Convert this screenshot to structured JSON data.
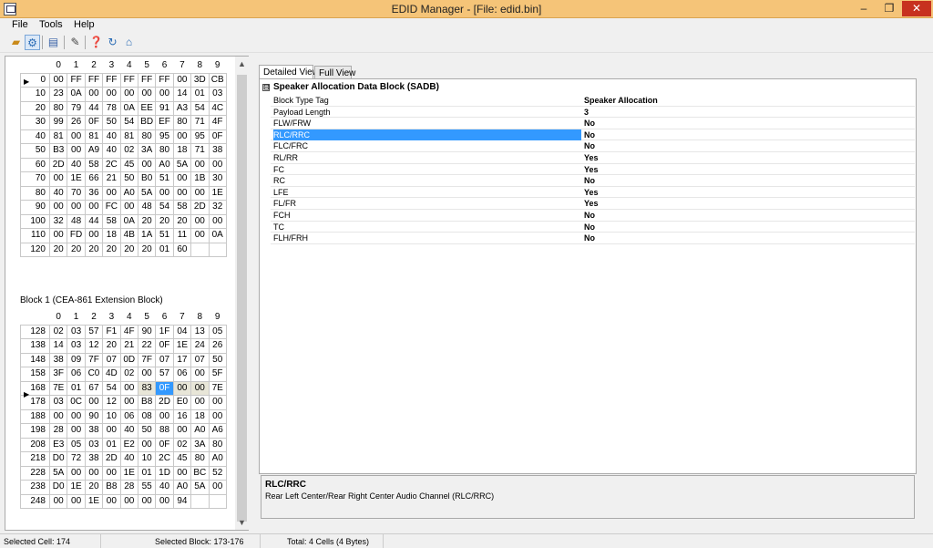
{
  "window": {
    "title": "EDID Manager - [File: edid.bin]"
  },
  "menu": {
    "file": "File",
    "tools": "Tools",
    "help": "Help"
  },
  "toolbar": {
    "icons": [
      "open-folder-icon",
      "settings-icon",
      "save-icon",
      "edit-icon",
      "help-icon",
      "refresh-icon",
      "home-icon"
    ]
  },
  "block0": {
    "columns": [
      "0",
      "1",
      "2",
      "3",
      "4",
      "5",
      "6",
      "7",
      "8",
      "9"
    ],
    "rows": [
      {
        "label": "0",
        "cells": [
          "00",
          "FF",
          "FF",
          "FF",
          "FF",
          "FF",
          "FF",
          "00",
          "3D",
          "CB"
        ]
      },
      {
        "label": "10",
        "cells": [
          "23",
          "0A",
          "00",
          "00",
          "00",
          "00",
          "00",
          "14",
          "01",
          "03"
        ]
      },
      {
        "label": "20",
        "cells": [
          "80",
          "79",
          "44",
          "78",
          "0A",
          "EE",
          "91",
          "A3",
          "54",
          "4C"
        ]
      },
      {
        "label": "30",
        "cells": [
          "99",
          "26",
          "0F",
          "50",
          "54",
          "BD",
          "EF",
          "80",
          "71",
          "4F"
        ]
      },
      {
        "label": "40",
        "cells": [
          "81",
          "00",
          "81",
          "40",
          "81",
          "80",
          "95",
          "00",
          "95",
          "0F"
        ]
      },
      {
        "label": "50",
        "cells": [
          "B3",
          "00",
          "A9",
          "40",
          "02",
          "3A",
          "80",
          "18",
          "71",
          "38"
        ]
      },
      {
        "label": "60",
        "cells": [
          "2D",
          "40",
          "58",
          "2C",
          "45",
          "00",
          "A0",
          "5A",
          "00",
          "00"
        ]
      },
      {
        "label": "70",
        "cells": [
          "00",
          "1E",
          "66",
          "21",
          "50",
          "B0",
          "51",
          "00",
          "1B",
          "30"
        ]
      },
      {
        "label": "80",
        "cells": [
          "40",
          "70",
          "36",
          "00",
          "A0",
          "5A",
          "00",
          "00",
          "00",
          "1E"
        ]
      },
      {
        "label": "90",
        "cells": [
          "00",
          "00",
          "00",
          "FC",
          "00",
          "48",
          "54",
          "58",
          "2D",
          "32"
        ]
      },
      {
        "label": "100",
        "cells": [
          "32",
          "48",
          "44",
          "58",
          "0A",
          "20",
          "20",
          "20",
          "00",
          "00"
        ]
      },
      {
        "label": "110",
        "cells": [
          "00",
          "FD",
          "00",
          "18",
          "4B",
          "1A",
          "51",
          "11",
          "00",
          "0A"
        ]
      },
      {
        "label": "120",
        "cells": [
          "20",
          "20",
          "20",
          "20",
          "20",
          "20",
          "01",
          "60",
          "",
          ""
        ]
      }
    ]
  },
  "block1": {
    "label": "Block 1 (CEA-861 Extension Block)",
    "columns": [
      "0",
      "1",
      "2",
      "3",
      "4",
      "5",
      "6",
      "7",
      "8",
      "9"
    ],
    "rows": [
      {
        "label": "128",
        "cells": [
          "02",
          "03",
          "57",
          "F1",
          "4F",
          "90",
          "1F",
          "04",
          "13",
          "05"
        ]
      },
      {
        "label": "138",
        "cells": [
          "14",
          "03",
          "12",
          "20",
          "21",
          "22",
          "0F",
          "1E",
          "24",
          "26"
        ]
      },
      {
        "label": "148",
        "cells": [
          "38",
          "09",
          "7F",
          "07",
          "0D",
          "7F",
          "07",
          "17",
          "07",
          "50"
        ]
      },
      {
        "label": "158",
        "cells": [
          "3F",
          "06",
          "C0",
          "4D",
          "02",
          "00",
          "57",
          "06",
          "00",
          "5F"
        ]
      },
      {
        "label": "168",
        "cells": [
          "7E",
          "01",
          "67",
          "54",
          "00",
          "83",
          "0F",
          "00",
          "00",
          "7E"
        ]
      },
      {
        "label": "178",
        "cells": [
          "03",
          "0C",
          "00",
          "12",
          "00",
          "B8",
          "2D",
          "E0",
          "00",
          "00"
        ]
      },
      {
        "label": "188",
        "cells": [
          "00",
          "00",
          "90",
          "10",
          "06",
          "08",
          "00",
          "16",
          "18",
          "00"
        ]
      },
      {
        "label": "198",
        "cells": [
          "28",
          "00",
          "38",
          "00",
          "40",
          "50",
          "88",
          "00",
          "A0",
          "A6"
        ]
      },
      {
        "label": "208",
        "cells": [
          "E3",
          "05",
          "03",
          "01",
          "E2",
          "00",
          "0F",
          "02",
          "3A",
          "80"
        ]
      },
      {
        "label": "218",
        "cells": [
          "D0",
          "72",
          "38",
          "2D",
          "40",
          "10",
          "2C",
          "45",
          "80",
          "A0"
        ]
      },
      {
        "label": "228",
        "cells": [
          "5A",
          "00",
          "00",
          "00",
          "1E",
          "01",
          "1D",
          "00",
          "BC",
          "52"
        ]
      },
      {
        "label": "238",
        "cells": [
          "D0",
          "1E",
          "20",
          "B8",
          "28",
          "55",
          "40",
          "A0",
          "5A",
          "00"
        ]
      },
      {
        "label": "248",
        "cells": [
          "00",
          "00",
          "1E",
          "00",
          "00",
          "00",
          "00",
          "94",
          "",
          ""
        ]
      }
    ]
  },
  "tabs": {
    "detailed": "Detailed View",
    "full": "Full View"
  },
  "detail": {
    "header": "Speaker Allocation Data Block (SADB)",
    "expand_glyph": "⊟",
    "properties": [
      {
        "name": "Block Type Tag",
        "value": "Speaker Allocation"
      },
      {
        "name": "Payload Length",
        "value": "3"
      },
      {
        "name": "FLW/FRW",
        "value": "No"
      },
      {
        "name": "RLC/RRC",
        "value": "No"
      },
      {
        "name": "FLC/FRC",
        "value": "No"
      },
      {
        "name": "RL/RR",
        "value": "Yes"
      },
      {
        "name": "FC",
        "value": "Yes"
      },
      {
        "name": "RC",
        "value": "No"
      },
      {
        "name": "LFE",
        "value": "Yes"
      },
      {
        "name": "FL/FR",
        "value": "Yes"
      },
      {
        "name": "FCH",
        "value": "No"
      },
      {
        "name": "TC",
        "value": "No"
      },
      {
        "name": "FLH/FRH",
        "value": "No"
      }
    ],
    "selected_property": "RLC/RRC"
  },
  "description": {
    "title": "RLC/RRC",
    "text": "Rear Left Center/Rear Right Center Audio Channel (RLC/RRC)"
  },
  "status": {
    "selected_cell": "Selected Cell: 174",
    "selected_block": "Selected Block: 173-176",
    "total": "Total: 4 Cells (4 Bytes)"
  },
  "colors": {
    "selection": "#3399ff",
    "title_bar": "#f5c478",
    "close_button": "#c7311f"
  }
}
